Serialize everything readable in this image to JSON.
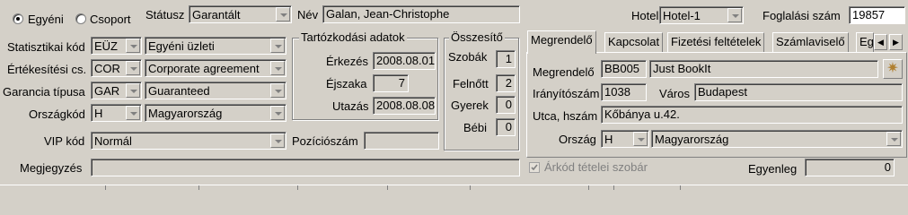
{
  "guest_type": {
    "individual": "Egyéni",
    "group": "Csoport",
    "selected": "individual"
  },
  "status": {
    "label": "Státusz",
    "value": "Garantált"
  },
  "name": {
    "label": "Név",
    "value": "Galan, Jean-Christophe"
  },
  "hotel": {
    "label": "Hotel",
    "value": "Hotel-1"
  },
  "booking_number": {
    "label": "Foglalási szám",
    "value": "19857"
  },
  "left_fields": {
    "stat_code": {
      "label": "Statisztikai kód",
      "code": "EÜZ",
      "desc": "Egyéni üzleti"
    },
    "sales_channel": {
      "label": "Értékesítési cs.",
      "code": "COR",
      "desc": "Corporate agreement"
    },
    "guarantee_type": {
      "label": "Garancia típusa",
      "code": "GAR",
      "desc": "Guaranteed"
    },
    "country_code": {
      "label": "Országkód",
      "code": "H",
      "desc": "Magyarország"
    },
    "vip": {
      "label": "VIP kód",
      "value": "Normál"
    },
    "note": {
      "label": "Megjegyzés",
      "value": ""
    }
  },
  "stay": {
    "title": "Tartózkodási adatok",
    "arrival_label": "Érkezés",
    "arrival": "2008.08.01.",
    "nights_label": "Éjszaka",
    "nights": "7",
    "departure_label": "Utazás",
    "departure": "2008.08.08."
  },
  "position": {
    "label": "Pozíciószám",
    "value": ""
  },
  "summary": {
    "title": "Összesítő",
    "rooms_label": "Szobák",
    "rooms": "1",
    "adults_label": "Felnőtt",
    "adults": "2",
    "children_label": "Gyerek",
    "children": "0",
    "babies_label": "Bébi",
    "babies": "0"
  },
  "tabs": [
    "Megrendelő",
    "Kapcsolat",
    "Fizetési feltételek",
    "Számlaviselő",
    "Eg"
  ],
  "customer": {
    "orderer_label": "Megrendelő",
    "orderer_code": "BB005",
    "orderer_name": "Just BookIt",
    "zip_label": "Irányítószám",
    "zip": "1038",
    "city_label": "Város",
    "city": "Budapest",
    "street_label": "Utca, hszám",
    "street": "Kőbánya u.42.",
    "country_label": "Ország",
    "country_code": "H",
    "country_name": "Magyarország"
  },
  "room_items": {
    "label": "Árkód tételei szobár",
    "checked": true
  },
  "balance": {
    "label": "Egyenleg",
    "value": "0"
  },
  "icons": {
    "radio": "radio-button",
    "arrow_left": "◀",
    "arrow_right": "▶",
    "lookup": "star-icon"
  }
}
